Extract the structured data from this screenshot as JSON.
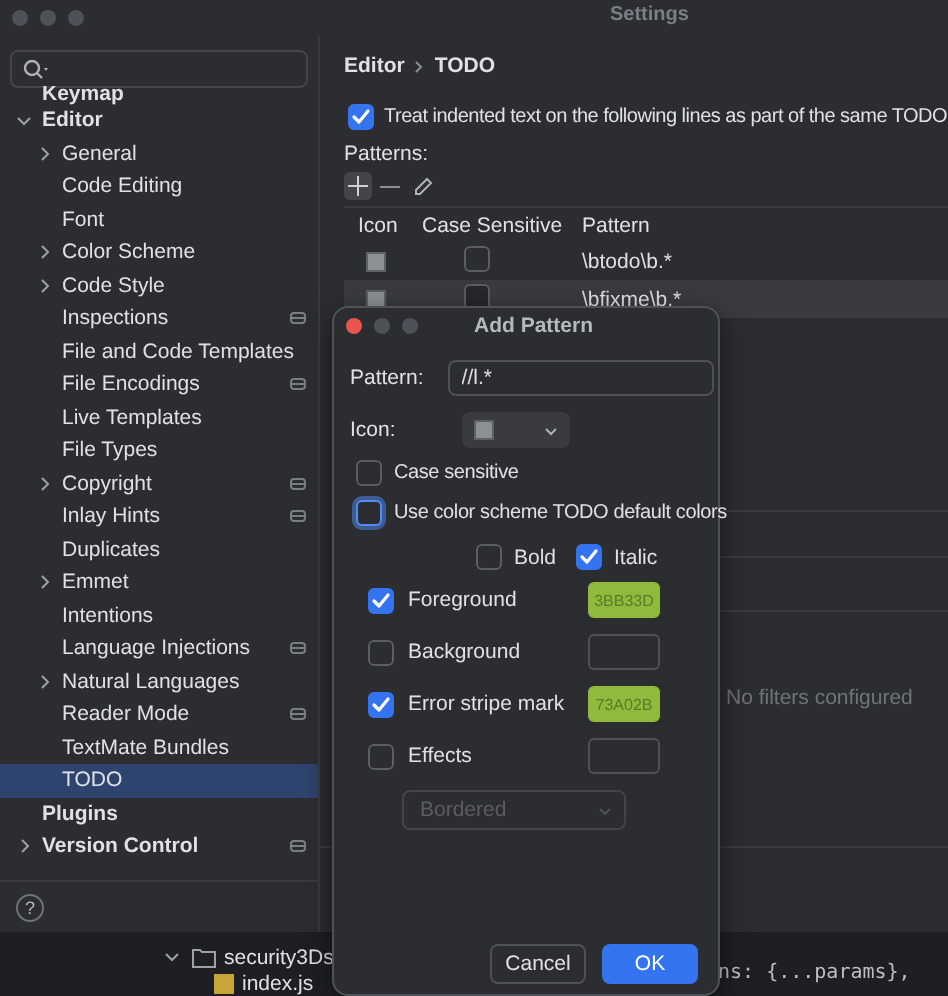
{
  "window": {
    "title": "Settings"
  },
  "sidebar": {
    "items": [
      {
        "label": "Keymap",
        "selected": false
      },
      {
        "label": "Editor",
        "selected": false,
        "expanded": true,
        "children": [
          {
            "label": "General",
            "selected": false,
            "expanded": false
          },
          {
            "label": "Code Editing",
            "selected": false
          },
          {
            "label": "Font",
            "selected": false
          },
          {
            "label": "Color Scheme",
            "selected": false,
            "expanded": false
          },
          {
            "label": "Code Style",
            "selected": false,
            "expanded": false
          },
          {
            "label": "Inspections",
            "selected": false,
            "project_level": true
          },
          {
            "label": "File and Code Templates",
            "selected": false
          },
          {
            "label": "File Encodings",
            "selected": false,
            "project_level": true
          },
          {
            "label": "Live Templates",
            "selected": false
          },
          {
            "label": "File Types",
            "selected": false
          },
          {
            "label": "Copyright",
            "selected": false,
            "expanded": false,
            "project_level": true
          },
          {
            "label": "Inlay Hints",
            "selected": false,
            "project_level": true
          },
          {
            "label": "Duplicates",
            "selected": false
          },
          {
            "label": "Emmet",
            "selected": false,
            "expanded": false
          },
          {
            "label": "Intentions",
            "selected": false
          },
          {
            "label": "Language Injections",
            "selected": false,
            "project_level": true
          },
          {
            "label": "Natural Languages",
            "selected": false,
            "expanded": false
          },
          {
            "label": "Reader Mode",
            "selected": false,
            "project_level": true
          },
          {
            "label": "TextMate Bundles",
            "selected": false
          },
          {
            "label": "TODO",
            "selected": true
          }
        ]
      },
      {
        "label": "Plugins",
        "selected": false
      },
      {
        "label": "Version Control",
        "selected": false,
        "expanded": false,
        "project_level": true
      }
    ]
  },
  "breadcrumb": [
    "Editor",
    "TODO"
  ],
  "treat_indented": {
    "label": "Treat indented text on the following lines as part of the same TODO",
    "checked": true
  },
  "patterns": {
    "label": "Patterns:",
    "columns": [
      "Icon",
      "Case Sensitive",
      "Pattern"
    ],
    "rows": [
      {
        "case_sensitive": false,
        "pattern": "\\btodo\\b.*",
        "selected": false
      },
      {
        "case_sensitive": false,
        "pattern": "\\bfixme\\b.*",
        "selected": true
      }
    ]
  },
  "filters": {
    "empty_text": "No filters configured"
  },
  "dialog": {
    "title": "Add Pattern",
    "pattern_label": "Pattern:",
    "pattern_value": "//l.*",
    "icon_label": "Icon:",
    "options": [
      {
        "label": "Case sensitive",
        "checked": false,
        "focused": false
      },
      {
        "label": "Use color scheme TODO default colors",
        "checked": false,
        "focused": true
      }
    ],
    "font_styles": [
      {
        "label": "Bold",
        "checked": false
      },
      {
        "label": "Italic",
        "checked": true
      }
    ],
    "attributes": [
      {
        "label": "Foreground",
        "checked": true,
        "value": "3BB33D",
        "color": "#8fba3c"
      },
      {
        "label": "Background",
        "checked": false
      },
      {
        "label": "Error stripe mark",
        "checked": true,
        "value": "73A02B",
        "color": "#8fba3c"
      },
      {
        "label": "Effects",
        "checked": false
      }
    ],
    "effect_style": {
      "value": "Bordered",
      "disabled": true
    },
    "buttons": [
      {
        "label": "Cancel",
        "kind": "secondary"
      },
      {
        "label": "OK",
        "kind": "primary"
      }
    ]
  },
  "ide": {
    "tree": [
      {
        "label": "security3Ds",
        "kind": "folder",
        "expanded": true
      },
      {
        "label": "index.js",
        "kind": "js"
      }
    ],
    "code": [
      "ns: {...params},"
    ]
  },
  "help": {
    "label": "?"
  }
}
